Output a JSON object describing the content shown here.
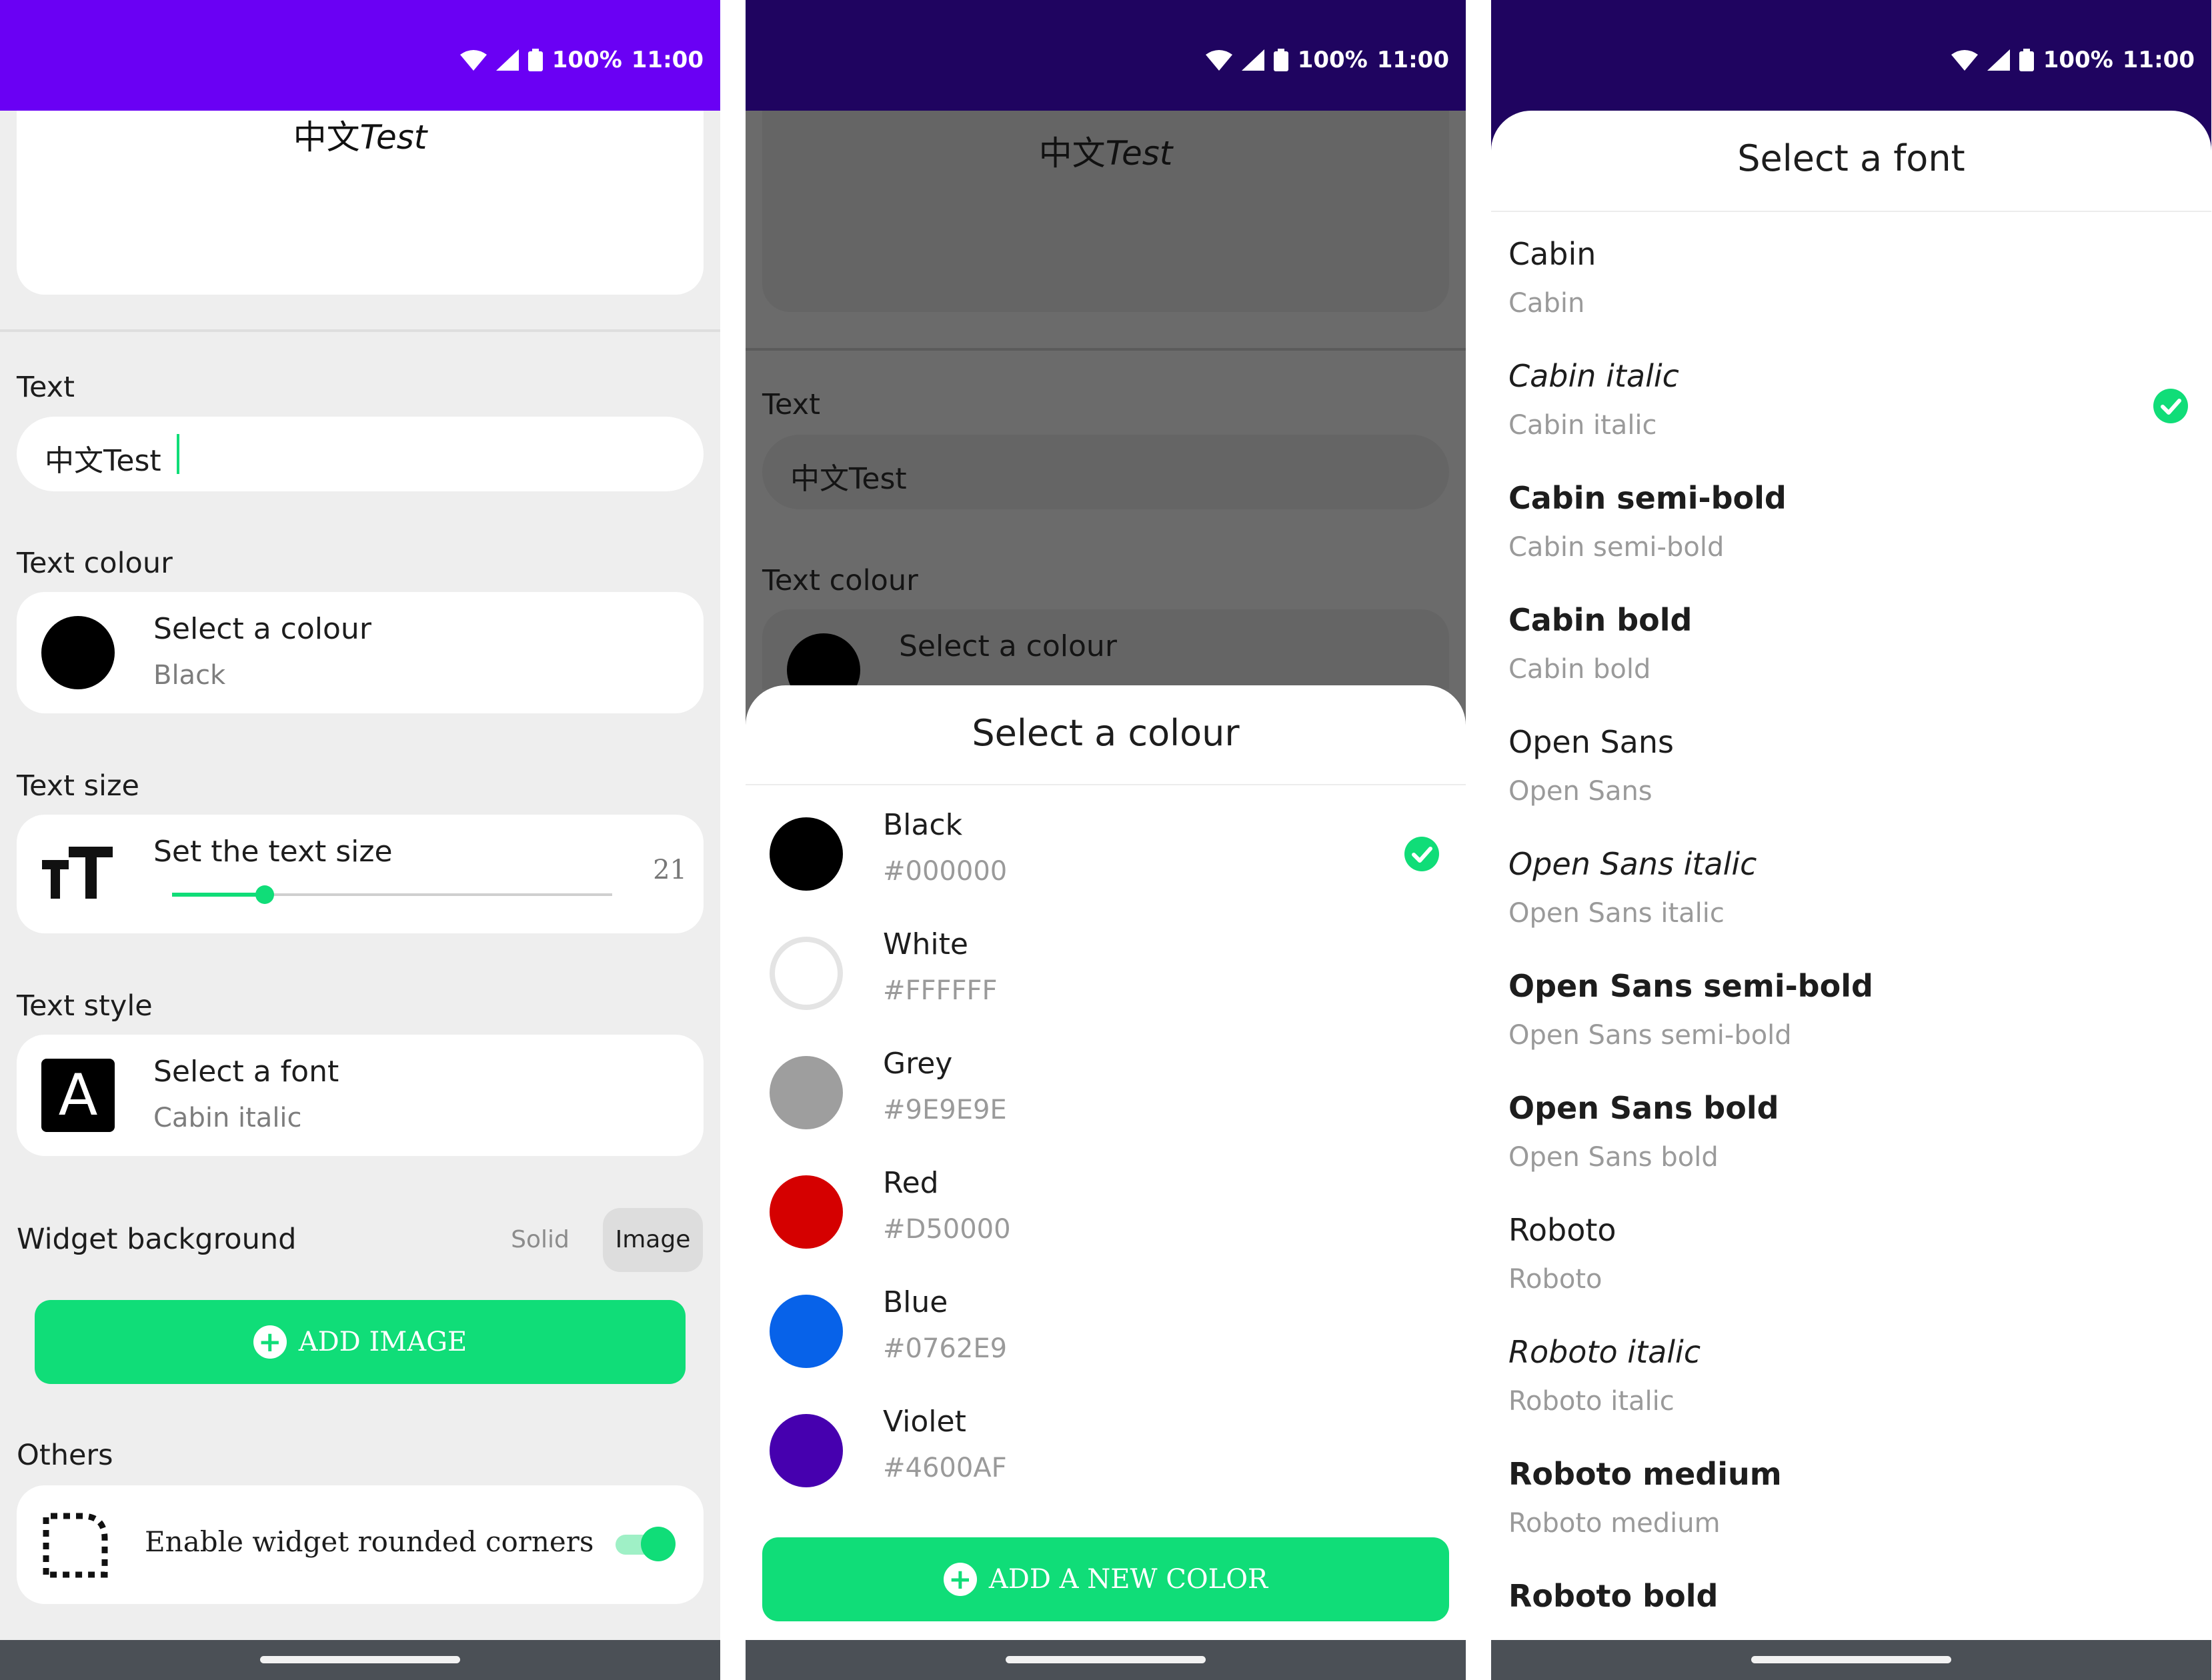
{
  "status": {
    "battery": "100%",
    "time": "11:00"
  },
  "editor": {
    "preview_text_cjk": "中文",
    "preview_text_latin": "Test",
    "text_section": "Text",
    "text_value": "中文Test",
    "colour_section": "Text colour",
    "colour_title": "Select a colour",
    "colour_value": "Black",
    "size_section": "Text size",
    "size_title": "Set the text size",
    "size_value": "21",
    "size_fraction": 0.21,
    "style_section": "Text style",
    "style_title": "Select a font",
    "style_value": "Cabin italic",
    "style_icon_letter": "A",
    "bg_section": "Widget background",
    "bg_option_solid": "Solid",
    "bg_option_image": "Image",
    "add_image_label": "ADD IMAGE",
    "others_section": "Others",
    "rounded_label": "Enable widget rounded corners",
    "rounded_on": true
  },
  "colour_sheet": {
    "title": "Select a colour",
    "items": [
      {
        "name": "Black",
        "hex": "#000000",
        "selected": true
      },
      {
        "name": "White",
        "hex": "#FFFFFF",
        "selected": false
      },
      {
        "name": "Grey",
        "hex": "#9E9E9E",
        "selected": false
      },
      {
        "name": "Red",
        "hex": "#D50000",
        "selected": false
      },
      {
        "name": "Blue",
        "hex": "#0762E9",
        "selected": false
      },
      {
        "name": "Violet",
        "hex": "#4600AF",
        "selected": false
      }
    ],
    "add_label": "ADD A NEW COLOR"
  },
  "font_sheet": {
    "title": "Select a font",
    "items": [
      {
        "name": "Cabin",
        "sub": "Cabin",
        "style": "normal",
        "weight": "normal",
        "selected": false
      },
      {
        "name": "Cabin italic",
        "sub": "Cabin italic",
        "style": "italic",
        "weight": "normal",
        "selected": true
      },
      {
        "name": "Cabin semi-bold",
        "sub": "Cabin semi-bold",
        "style": "normal",
        "weight": "600",
        "selected": false
      },
      {
        "name": "Cabin bold",
        "sub": "Cabin bold",
        "style": "normal",
        "weight": "bold",
        "selected": false
      },
      {
        "name": "Open Sans",
        "sub": "Open Sans",
        "style": "normal",
        "weight": "normal",
        "selected": false
      },
      {
        "name": "Open Sans italic",
        "sub": "Open Sans italic",
        "style": "italic",
        "weight": "normal",
        "selected": false
      },
      {
        "name": "Open Sans semi-bold",
        "sub": "Open Sans semi-bold",
        "style": "normal",
        "weight": "600",
        "selected": false
      },
      {
        "name": "Open Sans bold",
        "sub": "Open Sans bold",
        "style": "normal",
        "weight": "bold",
        "selected": false
      },
      {
        "name": "Roboto",
        "sub": "Roboto",
        "style": "normal",
        "weight": "normal",
        "selected": false
      },
      {
        "name": "Roboto italic",
        "sub": "Roboto italic",
        "style": "italic",
        "weight": "normal",
        "selected": false
      },
      {
        "name": "Roboto medium",
        "sub": "Roboto medium",
        "style": "normal",
        "weight": "600",
        "selected": false
      },
      {
        "name": "Roboto bold",
        "sub": "",
        "style": "normal",
        "weight": "bold",
        "selected": false
      }
    ]
  },
  "colors": {
    "statusbar_primary": "#6a00f4",
    "statusbar_dark": "#1f0460",
    "accent_green": "#10dd78",
    "screen_bg": "#eeeeee"
  },
  "icons": [
    "wifi-icon",
    "signal-icon",
    "battery-icon",
    "text-size-icon",
    "font-icon",
    "rounded-corners-icon",
    "plus-icon",
    "check-icon"
  ]
}
